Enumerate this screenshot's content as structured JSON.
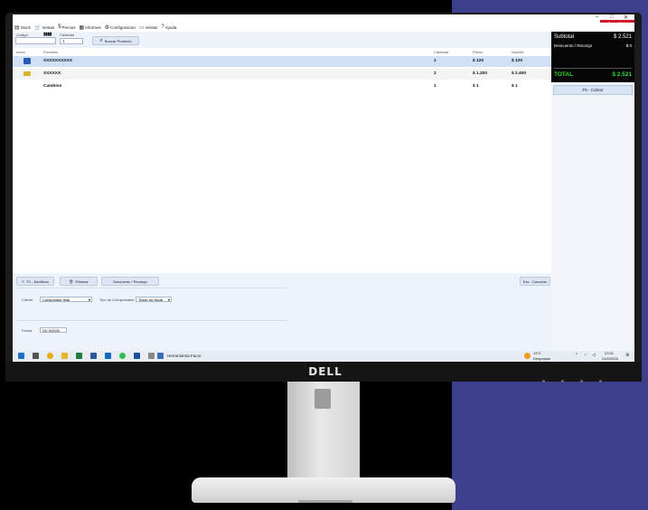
{
  "window": {
    "minimize": "–",
    "maximize": "□",
    "close": "✕",
    "cerrar_caja": "Cerrar Caja"
  },
  "menu": [
    {
      "label": "Stock",
      "icon": "box-icon",
      "glyph": "▤"
    },
    {
      "label": "Ventas",
      "icon": "cart-icon",
      "glyph": "🛒"
    },
    {
      "label": "Precios",
      "icon": "dollar-icon",
      "glyph": "$"
    },
    {
      "label": "Informes",
      "icon": "report-icon",
      "glyph": "▦"
    },
    {
      "label": "Configuracion",
      "icon": "gear-icon",
      "glyph": "⚙"
    },
    {
      "label": "Ventas",
      "icon": "folder-icon",
      "glyph": "▭"
    },
    {
      "label": "Ayuda",
      "icon": "help-icon",
      "glyph": "?"
    }
  ],
  "fields": {
    "codigo_label": "Codigo",
    "codigo_value": "",
    "cantidad_label": "Cantidad",
    "cantidad_value": "1",
    "buscar_label": "Buscar Producto"
  },
  "table": {
    "columns": [
      "Icono",
      "Producto",
      "Cantidad",
      "Precio",
      "Importe"
    ],
    "rows": [
      {
        "producto": "XXXXXXXXXX",
        "cantidad": "1",
        "precio": "$ 120",
        "importe": "$ 120",
        "selected": true,
        "thumb_color": "#2d57b8"
      },
      {
        "producto": "XXXXXX",
        "cantidad": "2",
        "precio": "$ 1.200",
        "importe": "$ 2.400",
        "selected": false,
        "thumb_color": "#d6b32a"
      },
      {
        "producto": "Cambios",
        "cantidad": "1",
        "precio": "$ 1",
        "importe": "$ 1",
        "selected": false,
        "thumb_color": ""
      }
    ]
  },
  "actions": {
    "modificar": "F1 - Modificar",
    "eliminar": "Eliminar",
    "descuento": "Descuento / Recargo",
    "cancelar": "Esc - Cancelar"
  },
  "form": {
    "cliente_label": "Cliente",
    "cliente_value": "Consumidor final",
    "tipo_label": "Tipo de Comprobante",
    "tipo_value": "Ticket sin fiscal",
    "fecha_label": "Fecha",
    "fecha_value": "24/ 9/2025"
  },
  "totals": {
    "subtotal_label": "Subtotal",
    "subtotal_value": "$ 2.521",
    "desc_label": "Descuento / Recargo",
    "desc_value": "$ 0",
    "total_label": "TOTAL",
    "total_value": "$ 2.521",
    "cobrar": "F5 - Cobrar"
  },
  "taskbar": {
    "app_label": "Herramienta Facor",
    "weather_temp": "19°C",
    "weather_desc": "Despejado",
    "time": "23:31",
    "date": "24/9/2025"
  },
  "monitor": {
    "brand": "DELL"
  },
  "colors": {
    "accent_red": "#d11a2a",
    "total_green": "#2bdc2b",
    "selected_row": "#cfe0f7"
  }
}
